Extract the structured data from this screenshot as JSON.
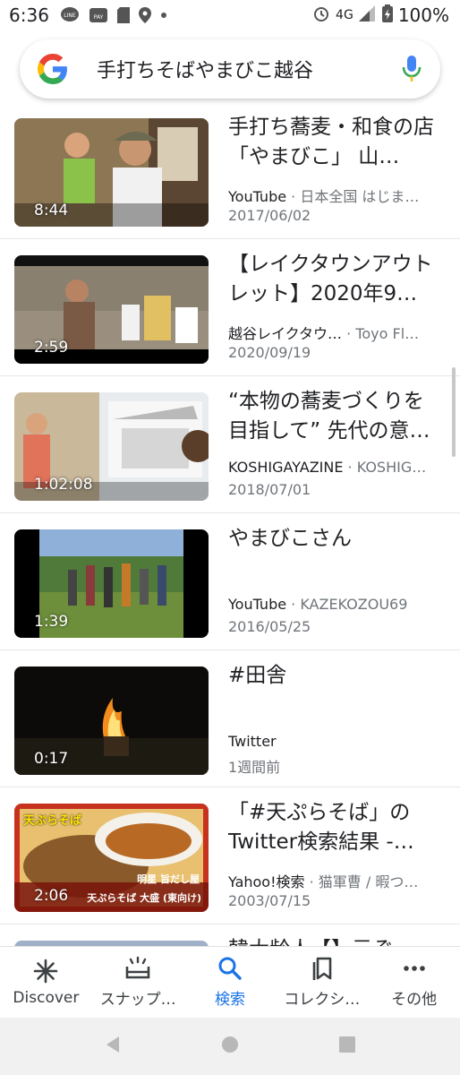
{
  "status_bar": {
    "time": "6:36",
    "network": "4G",
    "battery": "100%"
  },
  "search": {
    "query": "手打ちそばやまびこ越谷"
  },
  "results": [
    {
      "title": "手打ち蕎麦・和食の店「やまびこ」 山…",
      "source": "YouTube",
      "channel": "日本全国 はじま…",
      "date": "2017/06/02",
      "duration": "8:44"
    },
    {
      "title": "【レイクタウンアウトレット】2020年9…",
      "source": "越谷レイクタウ…",
      "channel": "Toyo Fl…",
      "date": "2020/09/19",
      "duration": "2:59"
    },
    {
      "title": "“本物の蕎麦づくりを目指して” 先代の意…",
      "source": "KOSHIGAYAZINE",
      "channel": "KOSHIG…",
      "date": "2018/07/01",
      "duration": "1:02:08"
    },
    {
      "title": "やまびこさん",
      "source": "YouTube",
      "channel": "KAZEKOZOU69",
      "date": "2016/05/25",
      "duration": "1:39"
    },
    {
      "title": "#田舎",
      "source": "Twitter",
      "channel": "",
      "date": "1週間前",
      "duration": "0:17"
    },
    {
      "title": "「#天ぷらそば」のTwitter検索結果 -…",
      "source": "Yahoo!検索",
      "channel": "猫軍曹 / 暇つ…",
      "date": "2003/07/15",
      "duration": "2:06"
    },
    {
      "title": "韓大龄人【】元ぞ…",
      "source": "",
      "channel": "",
      "date": "",
      "duration": ""
    }
  ],
  "thumb_text": {
    "r6_top": "天ぷらそば",
    "r6_brand": "明星 旨だし屋",
    "r6_product": "天ぷらそば 大盛 (東向け)"
  },
  "bottom_nav": [
    {
      "label": "Discover",
      "icon": "asterisk-icon",
      "active": false
    },
    {
      "label": "スナップ…",
      "icon": "snapshot-icon",
      "active": false
    },
    {
      "label": "検索",
      "icon": "search-icon",
      "active": true
    },
    {
      "label": "コレクシ…",
      "icon": "collections-icon",
      "active": false
    },
    {
      "label": "その他",
      "icon": "more-icon",
      "active": false
    }
  ],
  "colors": {
    "accent": "#1a73e8",
    "text_primary": "#202124",
    "text_secondary": "#70757a"
  }
}
